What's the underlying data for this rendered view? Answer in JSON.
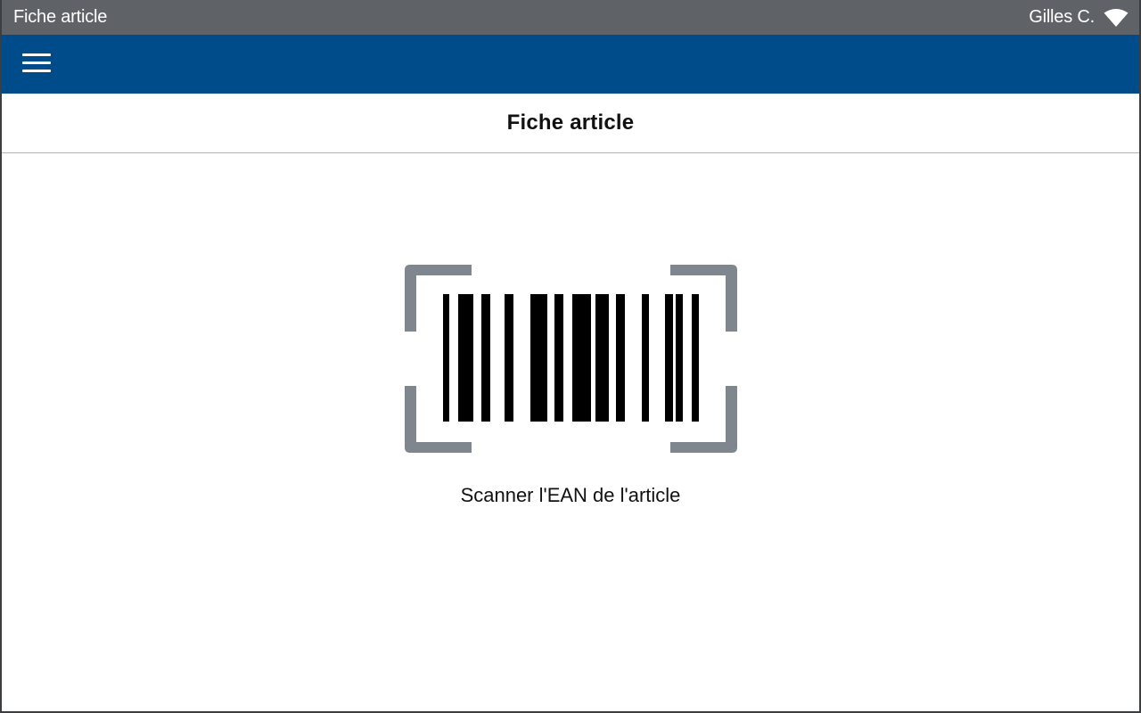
{
  "status_bar": {
    "title": "Fiche article",
    "user": "Gilles C."
  },
  "app_bar": {
    "menu_icon": "hamburger-menu-icon",
    "background": "#004c8b"
  },
  "page": {
    "title": "Fiche article"
  },
  "scanner": {
    "icon": "barcode-scan-icon",
    "frame_color": "#80868d",
    "instruction": "Scanner l'EAN de l'article"
  }
}
